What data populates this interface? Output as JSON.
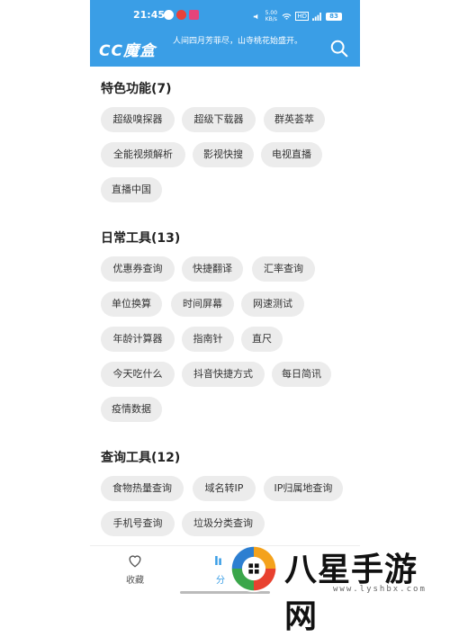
{
  "status_bar": {
    "time": "21:45",
    "signal_text": "5.00 KB/s",
    "network": "HD",
    "battery": "83"
  },
  "header": {
    "logo": "CC魔盒",
    "motto": "人间四月芳菲尽，山寺桃花始盛开。"
  },
  "sections": [
    {
      "title": "特色功能(7)",
      "items": [
        "超级嗅探器",
        "超级下载器",
        "群英荟萃",
        "全能视频解析",
        "影视快搜",
        "电视直播",
        "直播中国"
      ]
    },
    {
      "title": "日常工具(13)",
      "items": [
        "优惠券查询",
        "快捷翻译",
        "汇率查询",
        "单位换算",
        "时间屏幕",
        "网速测试",
        "年龄计算器",
        "指南针",
        "直尺",
        "今天吃什么",
        "抖音快捷方式",
        "每日简讯",
        "疫情数据"
      ]
    },
    {
      "title": "查询工具(12)",
      "items": [
        "食物热量查询",
        "域名转IP",
        "IP归属地查询",
        "手机号查询",
        "垃圾分类查询"
      ]
    }
  ],
  "tabbar": {
    "favorites": "收藏",
    "category": "分"
  },
  "watermark": {
    "text": "八星手游网",
    "url": "www.lyshbx.com"
  },
  "colors": {
    "accent": "#3a9ee6",
    "chip_bg": "#ececec"
  }
}
